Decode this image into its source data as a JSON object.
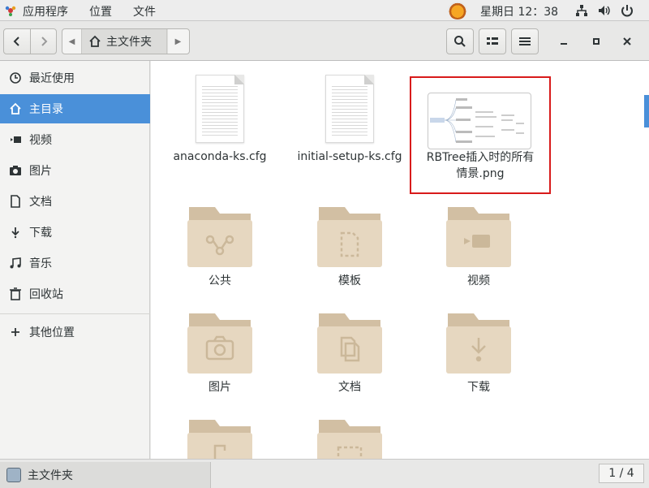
{
  "topbar": {
    "applications_label": "应用程序",
    "places_label": "位置",
    "file_label": "文件",
    "clock": "星期日 12：38"
  },
  "header": {
    "path_home_label": "主文件夹"
  },
  "sidebar": {
    "items": [
      {
        "label": "最近使用",
        "icon": "clock-icon",
        "active": false
      },
      {
        "label": "主目录",
        "icon": "home-icon",
        "active": true
      },
      {
        "label": "视频",
        "icon": "video-icon",
        "active": false
      },
      {
        "label": "图片",
        "icon": "camera-icon",
        "active": false
      },
      {
        "label": "文档",
        "icon": "document-icon",
        "active": false
      },
      {
        "label": "下载",
        "icon": "download-icon",
        "active": false
      },
      {
        "label": "音乐",
        "icon": "music-icon",
        "active": false
      },
      {
        "label": "回收站",
        "icon": "trash-icon",
        "active": false
      }
    ],
    "other_locations_label": "其他位置"
  },
  "files": [
    {
      "name": "anaconda-ks.cfg",
      "type": "document"
    },
    {
      "name": "initial-setup-ks.cfg",
      "type": "document"
    },
    {
      "name": "RBTree插入时的所有情景.png",
      "type": "image",
      "selected": true
    }
  ],
  "png_label_line1": "RBTree插入时的所有",
  "png_label_line2": "情景.png",
  "folders": [
    {
      "name": "公共",
      "emblem": "share-icon"
    },
    {
      "name": "模板",
      "emblem": "template-icon"
    },
    {
      "name": "视频",
      "emblem": "video-icon"
    },
    {
      "name": "图片",
      "emblem": "camera-icon"
    },
    {
      "name": "文档",
      "emblem": "documents-icon"
    },
    {
      "name": "下载",
      "emblem": "download-icon"
    }
  ],
  "status": {
    "tab_label": "主文件夹",
    "pager": "1 / 4"
  },
  "colors": {
    "accent": "#4a90d9",
    "folder": "#e6d7c0",
    "folder_dark": "#d2bfa3",
    "selection_border": "#d81b1b"
  }
}
